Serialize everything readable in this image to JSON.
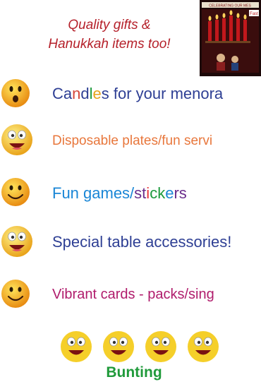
{
  "tagline": {
    "line1": "Quality gifts &",
    "line2": "Hanukkah items too!"
  },
  "book": {
    "cover_title": "CELEBRATING OUR MES",
    "label": "Fast"
  },
  "items": [
    {
      "parts": [
        {
          "t": "Ca",
          "c": "#2e3f94"
        },
        {
          "t": "n",
          "c": "#d6473a"
        },
        {
          "t": "d",
          "c": "#2e3f94"
        },
        {
          "t": "l",
          "c": "#1c9a3c"
        },
        {
          "t": "e",
          "c": "#e8a21a"
        },
        {
          "t": "s for your menora",
          "c": "#2e3f94"
        }
      ]
    },
    {
      "parts": [
        {
          "t": "Disposable plates/fun servi",
          "c": "#e8773c"
        }
      ]
    },
    {
      "parts": [
        {
          "t": "Fun games/",
          "c": "#1a86d6"
        },
        {
          "t": "st",
          "c": "#6a2d8c"
        },
        {
          "t": "i",
          "c": "#e8333a"
        },
        {
          "t": "ck",
          "c": "#1c9a3c"
        },
        {
          "t": "e",
          "c": "#1a86d6"
        },
        {
          "t": "rs",
          "c": "#6a2d8c"
        }
      ]
    },
    {
      "parts": [
        {
          "t": "Special table accessories!",
          "c": "#2e3f94"
        }
      ]
    },
    {
      "parts": [
        {
          "t": "Vibrant cards - packs/sing",
          "c": "#b01c6c"
        }
      ]
    }
  ],
  "bunting_label": "Bunting",
  "colors": {
    "tagline": "#b5202a",
    "bunting": "#1f9a3a",
    "smiley_yellow": "#f7d21c",
    "smiley_orange": "#e88c12"
  },
  "icons": [
    "surprised-smiley-icon",
    "grinning-smiley-icon",
    "happy-smiley-icon",
    "grinning-smiley-icon",
    "happy-smiley-icon"
  ]
}
